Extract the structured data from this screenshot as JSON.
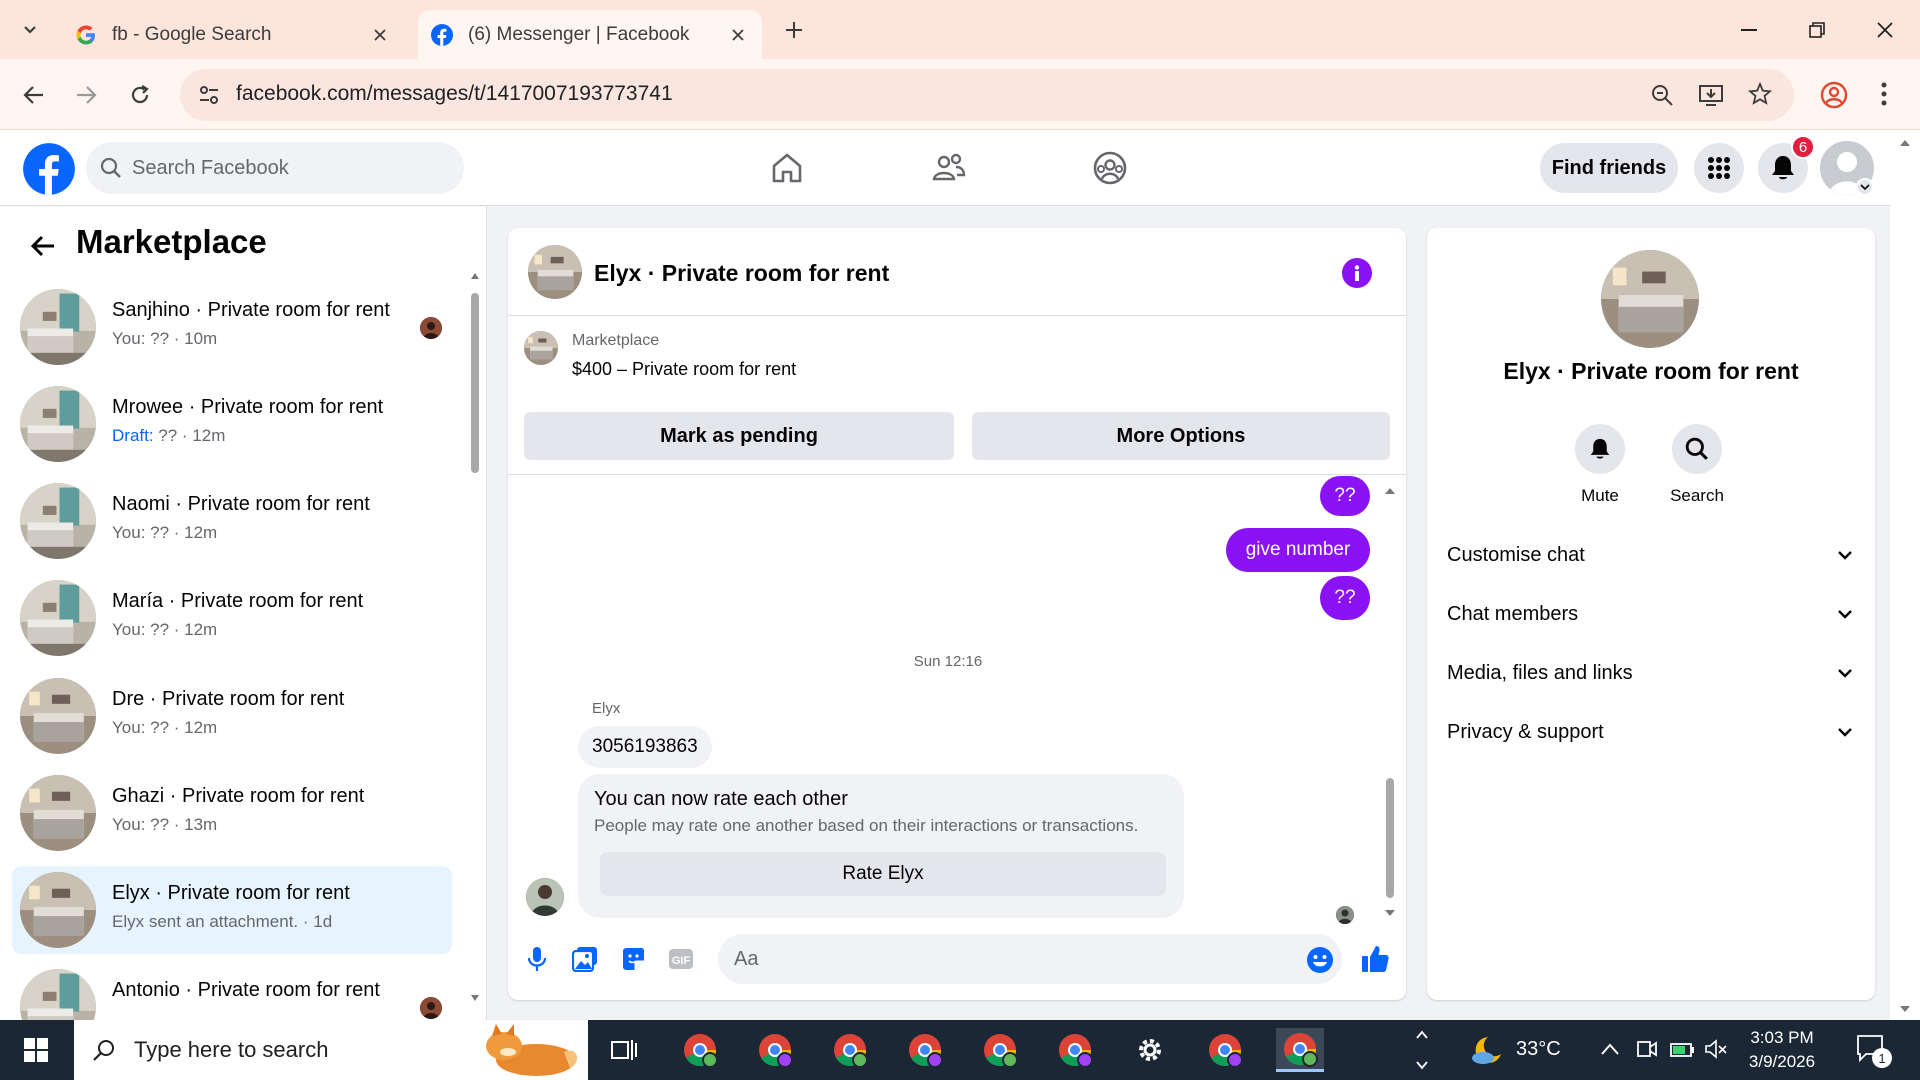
{
  "browser": {
    "tabs": [
      {
        "title": "fb - Google Search",
        "favicon": "google-g-icon"
      },
      {
        "title": "(6) Messenger | Facebook",
        "favicon": "facebook-icon"
      }
    ],
    "url": "facebook.com/messages/t/1417007193773741"
  },
  "header": {
    "search_placeholder": "Search Facebook",
    "find_friends": "Find friends",
    "notification_count": "6"
  },
  "sidebar": {
    "title": "Marketplace",
    "conversations": [
      {
        "name": "Sanjhino · Private room for rent",
        "preview": "You: ?? · 10m",
        "draft": "",
        "active": false
      },
      {
        "name": "Mrowee · Private room for rent",
        "preview": " ?? · 12m",
        "draft": "Draft:",
        "active": false
      },
      {
        "name": "Naomi · Private room for rent",
        "preview": "You: ?? · 12m",
        "draft": "",
        "active": false
      },
      {
        "name": "María · Private room for rent",
        "preview": "You: ?? · 12m",
        "draft": "",
        "active": false
      },
      {
        "name": "Dre · Private room for rent",
        "preview": "You: ?? · 12m",
        "draft": "",
        "active": false
      },
      {
        "name": "Ghazi · Private room for rent",
        "preview": "You: ?? · 13m",
        "draft": "",
        "active": false
      },
      {
        "name": "Elyx · Private room for rent",
        "preview": "Elyx sent an attachment. · 1d",
        "draft": "",
        "active": true
      },
      {
        "name": "Antonio · Private room for rent",
        "preview": "",
        "draft": "",
        "active": false
      }
    ]
  },
  "chat": {
    "title": "Elyx · Private room for rent",
    "marketplace_label": "Marketplace",
    "listing": "$400 – Private room for rent",
    "mark_pending": "Mark as pending",
    "more_options": "More Options",
    "messages": {
      "me_1": "??",
      "me_2": "give number",
      "me_3": "??",
      "timestamp": "Sun 12:16",
      "sender": "Elyx",
      "them_1": "3056193863"
    },
    "rate": {
      "title": "You can now rate each other",
      "description": "People may rate one another based on their interactions or transactions.",
      "button": "Rate Elyx"
    },
    "composer_placeholder": "Aa"
  },
  "info": {
    "title": "Elyx · Private room for rent",
    "mute": "Mute",
    "search": "Search",
    "sections": [
      "Customise chat",
      "Chat members",
      "Media, files and links",
      "Privacy & support"
    ]
  },
  "taskbar": {
    "search_placeholder": "Type here to search",
    "temperature": "33°C",
    "time": "3:03 PM",
    "date": "3/9/2026",
    "notification_count": "1"
  },
  "colors": {
    "fb_blue": "#0866ff",
    "messenger_purple": "#8a12f4",
    "chrome_tab_bg": "#fde5dc"
  }
}
